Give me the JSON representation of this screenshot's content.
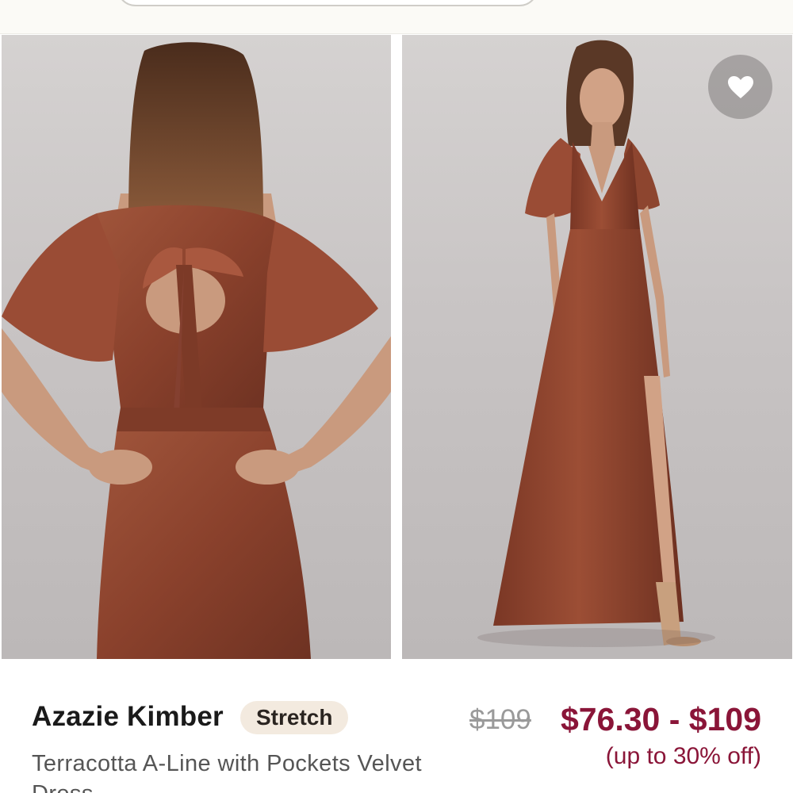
{
  "header": {
    "search_icon": "search-bar"
  },
  "gallery": {
    "images": [
      {
        "view": "back",
        "description_icon": "dress-back-photo"
      },
      {
        "view": "front",
        "description_icon": "dress-front-photo"
      }
    ],
    "favorite_icon": "heart-icon"
  },
  "product": {
    "name": "Azazie Kimber",
    "badge": "Stretch",
    "subtitle": "Terracotta A-Line with Pockets Velvet Dress",
    "original_price": "$109",
    "price_range": "$76.30 - $109",
    "discount_note": "(up to 30% off)"
  },
  "colors": {
    "dress": "#8f4530",
    "price_accent": "#8a1538",
    "badge_bg": "#f3eadf"
  }
}
